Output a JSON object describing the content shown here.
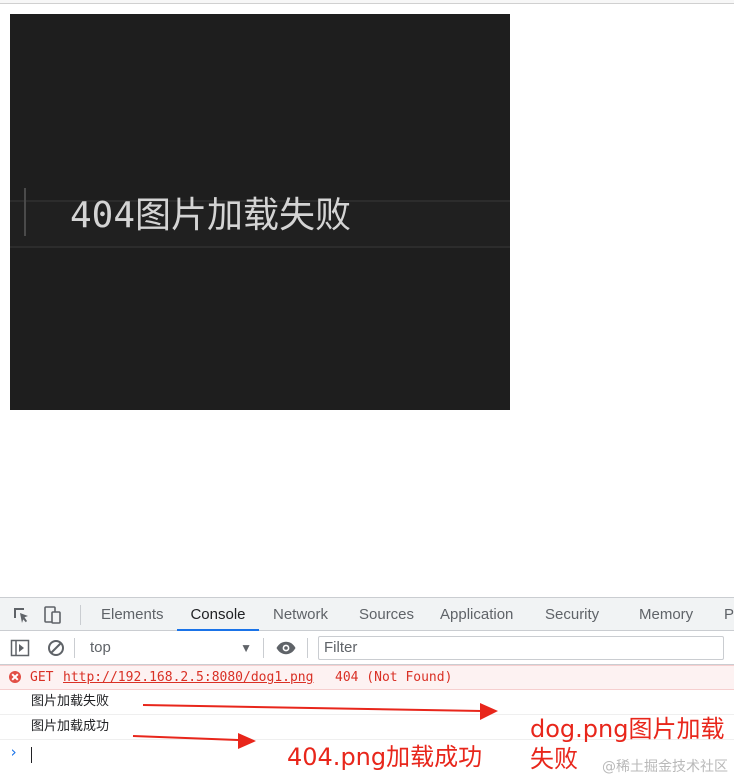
{
  "image": {
    "text_code": "404",
    "text_message": "图片加载失败"
  },
  "devtools": {
    "tabs": [
      {
        "label": "Elements"
      },
      {
        "label": "Console"
      },
      {
        "label": "Network"
      },
      {
        "label": "Sources"
      },
      {
        "label": "Application"
      },
      {
        "label": "Security"
      },
      {
        "label": "Memory"
      },
      {
        "label": "Pe"
      }
    ],
    "active_tab": "Console",
    "context_selector": "top",
    "filter_placeholder": "Filter",
    "console": {
      "error": {
        "method": "GET",
        "url": "http://192.168.2.5:8080/dog1.png",
        "status": "404 (Not Found)"
      },
      "logs": [
        {
          "text": "图片加载失败"
        },
        {
          "text": "图片加载成功"
        }
      ],
      "prompt": "›"
    }
  },
  "annotations": {
    "right_line1": "dog.png图片加载",
    "right_line2": "失败",
    "middle": "404.png加载成功",
    "color": "#e8261b"
  },
  "watermark": "@稀土掘金技术社区"
}
